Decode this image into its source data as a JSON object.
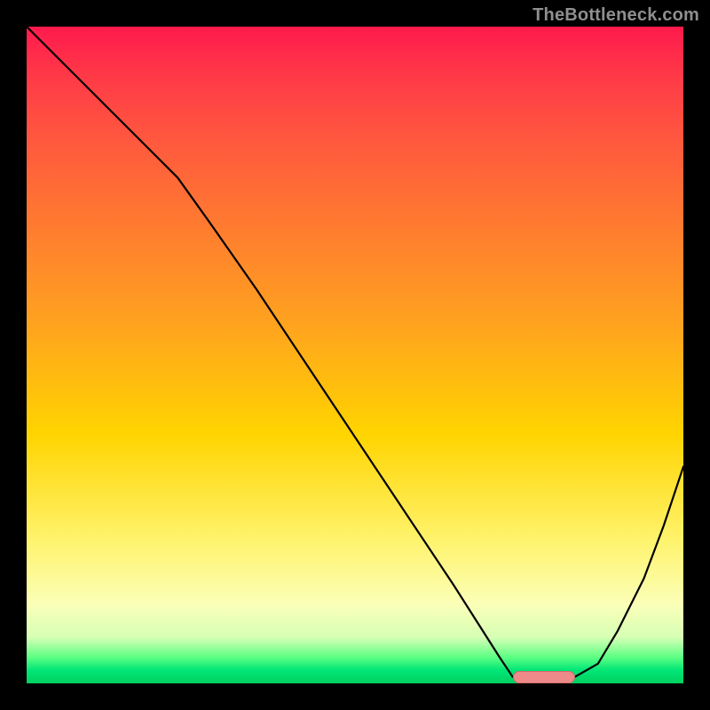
{
  "watermark": "TheBottleneck.com",
  "marker": {
    "x_fraction_start": 0.74,
    "x_fraction_end": 0.835,
    "y_fraction": 0.9905,
    "color": "#ef8a8a"
  },
  "gradient_stops": [
    {
      "offset": 0.0,
      "color": "#ff1a4d"
    },
    {
      "offset": 0.08,
      "color": "#ff3b47"
    },
    {
      "offset": 0.18,
      "color": "#ff5a3e"
    },
    {
      "offset": 0.3,
      "color": "#ff7a30"
    },
    {
      "offset": 0.45,
      "color": "#ffa21f"
    },
    {
      "offset": 0.62,
      "color": "#ffd400"
    },
    {
      "offset": 0.78,
      "color": "#fff36b"
    },
    {
      "offset": 0.88,
      "color": "#fbffb8"
    },
    {
      "offset": 0.93,
      "color": "#d6ffb5"
    },
    {
      "offset": 0.96,
      "color": "#5eff84"
    },
    {
      "offset": 0.98,
      "color": "#00e676"
    },
    {
      "offset": 1.0,
      "color": "#00d060"
    }
  ],
  "chart_data": {
    "type": "line",
    "title": "",
    "xlabel": "",
    "ylabel": "",
    "xlim": [
      0,
      1
    ],
    "ylim": [
      0,
      1
    ],
    "x": [
      0.0,
      0.05,
      0.1,
      0.15,
      0.2,
      0.23,
      0.28,
      0.35,
      0.45,
      0.55,
      0.65,
      0.72,
      0.74,
      0.76,
      0.8,
      0.835,
      0.87,
      0.9,
      0.94,
      0.97,
      1.0
    ],
    "values": [
      1.0,
      0.95,
      0.9,
      0.85,
      0.8,
      0.77,
      0.7,
      0.6,
      0.45,
      0.3,
      0.15,
      0.04,
      0.01,
      0.01,
      0.01,
      0.01,
      0.03,
      0.08,
      0.16,
      0.24,
      0.33
    ],
    "annotations": [
      {
        "type": "band",
        "x_start": 0.74,
        "x_end": 0.835,
        "y": 0.01,
        "color": "#ef8a8a"
      }
    ]
  }
}
